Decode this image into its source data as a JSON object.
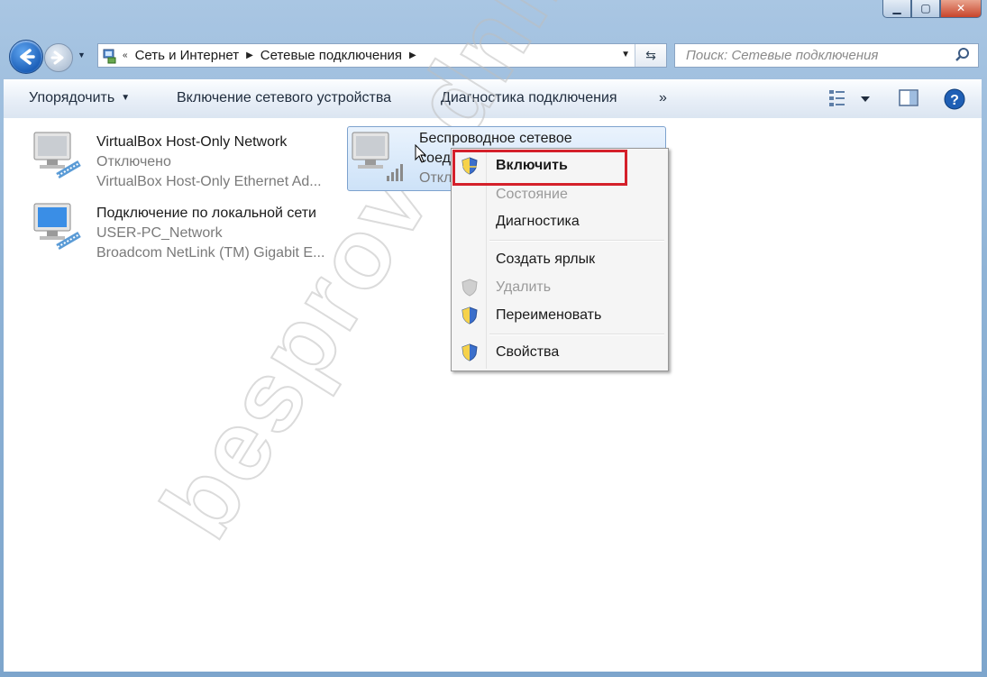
{
  "address": {
    "prefix": "«",
    "crumbs": [
      "Сеть и Интернет",
      "Сетевые подключения"
    ]
  },
  "search": {
    "placeholder": "Поиск: Сетевые подключения"
  },
  "toolbar": {
    "organize": "Упорядочить",
    "enable_device": "Включение сетевого устройства",
    "diagnose": "Диагностика подключения",
    "more": "»"
  },
  "connections": [
    {
      "name": "VirtualBox Host-Only Network",
      "status": "Отключено",
      "device": "VirtualBox Host-Only Ethernet Ad..."
    },
    {
      "name": "Подключение по локальной сети",
      "status": "USER-PC_Network",
      "device": "Broadcom NetLink (TM) Gigabit E..."
    },
    {
      "name": "Беспроводное сетевое",
      "name_line2": "соед",
      "status": "Откл"
    }
  ],
  "context_menu": {
    "items": [
      {
        "label": "Включить",
        "default": true,
        "shield": true,
        "enabled": true
      },
      {
        "label": "Состояние",
        "enabled": false
      },
      {
        "label": "Диагностика",
        "enabled": true
      },
      {
        "label": "Создать ярлык",
        "enabled": true
      },
      {
        "label": "Удалить",
        "enabled": false,
        "shield": true
      },
      {
        "label": "Переименовать",
        "enabled": true,
        "shield": true
      },
      {
        "label": "Свойства",
        "enabled": true,
        "shield": true
      }
    ]
  },
  "watermark": "besprovodnik.ru",
  "colors": {
    "highlight": "#d4202a",
    "selection": "#cde2f8",
    "accent": "#1c5fb8"
  }
}
